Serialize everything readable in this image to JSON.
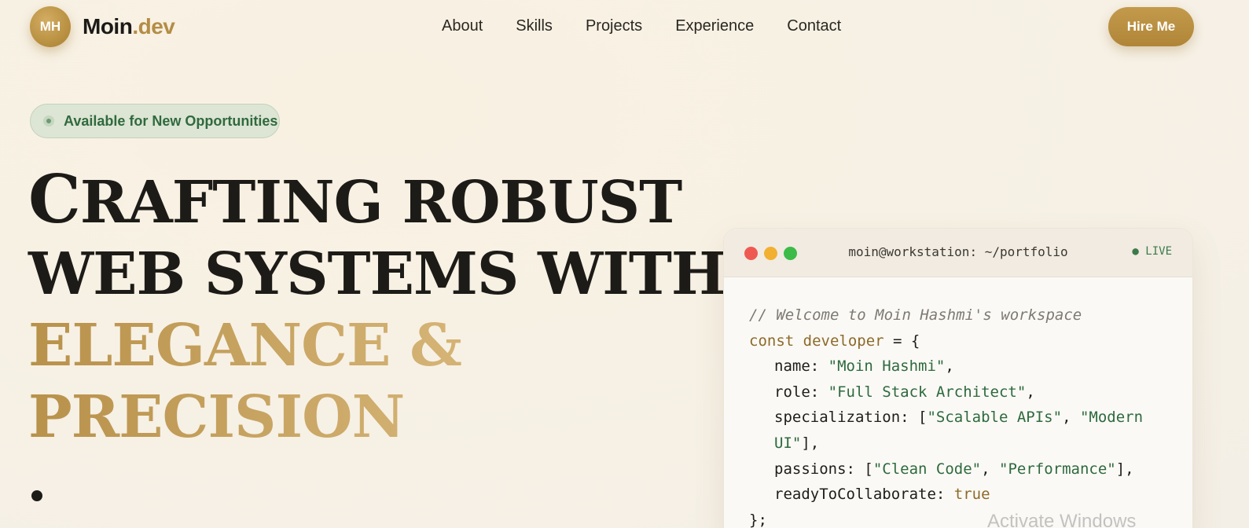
{
  "nav": {
    "logo_initials": "MH",
    "logo_name": "Moin",
    "logo_tld": ".dev",
    "links": [
      "About",
      "Skills",
      "Projects",
      "Experience",
      "Contact"
    ],
    "cta": "Hire Me"
  },
  "hero": {
    "badge": "Available for New Opportunities",
    "headline_lines": [
      {
        "cap": "C",
        "rest": "RAFTING ROBUST"
      },
      {
        "cap": "",
        "rest": "WEB SYSTEMS WITH"
      },
      {
        "cap": "",
        "rest": "ELEGANCE &"
      },
      {
        "cap": "",
        "rest": "PRECISION"
      }
    ]
  },
  "terminal": {
    "title": "moin@workstation: ~/portfolio",
    "status": "● LIVE",
    "code": {
      "comment": "// Welcome to Moin Hashmi's workspace",
      "decl_kw": "const developer",
      "decl_rest": " = {",
      "name_key": "name: ",
      "name_val": "\"Moin Hashmi\"",
      "role_key": "role: ",
      "role_val": "\"Full Stack Architect\"",
      "spec_key": "specialization: [",
      "spec_val1": "\"Scalable APIs\"",
      "spec_sep": ", ",
      "spec_val2a": "\"Modern",
      "spec_val2b": "UI\"",
      "spec_end": "],",
      "pass_key": "passions: [",
      "pass_val1": "\"Clean Code\"",
      "pass_sep": ", ",
      "pass_val2": "\"Performance\"",
      "pass_end": "],",
      "ready_key": "readyToCollaborate: ",
      "ready_val": "true",
      "close": "};"
    }
  },
  "watermark": "Activate Windows",
  "colors": {
    "accent_gold": "#b48d45",
    "badge_green": "#2f6a3e",
    "background": "#f7f1e5"
  }
}
